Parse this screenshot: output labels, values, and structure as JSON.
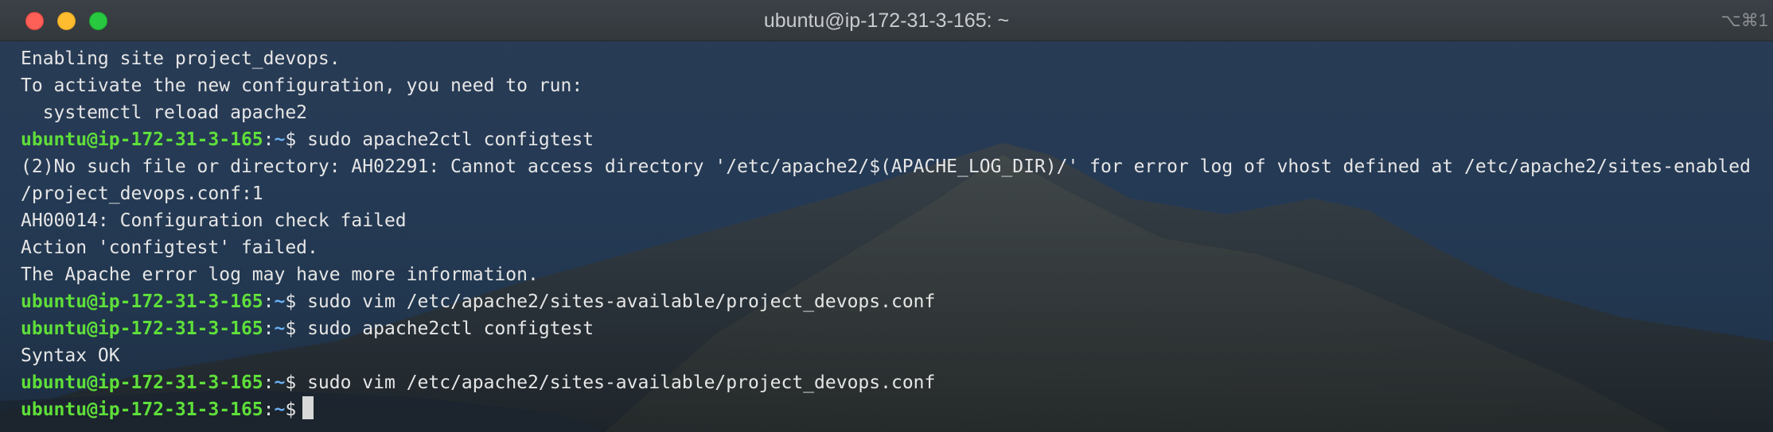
{
  "window": {
    "title": "ubuntu@ip-172-31-3-165: ~",
    "shortcut": "⌥⌘1"
  },
  "terminal": {
    "prompt_user": "ubuntu@ip-172-31-3-165",
    "prompt_path": "~",
    "prompt_symbol": "$",
    "lines": [
      {
        "type": "output",
        "text": "Enabling site project_devops."
      },
      {
        "type": "output",
        "text": "To activate the new configuration, you need to run:"
      },
      {
        "type": "output",
        "text": "  systemctl reload apache2"
      },
      {
        "type": "prompt",
        "text": " sudo apache2ctl configtest"
      },
      {
        "type": "output",
        "text": "(2)No such file or directory: AH02291: Cannot access directory '/etc/apache2/$(APACHE_LOG_DIR)/' for error log of vhost defined at /etc/apache2/sites-enabled"
      },
      {
        "type": "output",
        "text": "/project_devops.conf:1"
      },
      {
        "type": "output",
        "text": "AH00014: Configuration check failed"
      },
      {
        "type": "output",
        "text": "Action 'configtest' failed."
      },
      {
        "type": "output",
        "text": "The Apache error log may have more information."
      },
      {
        "type": "prompt",
        "text": " sudo vim /etc/apache2/sites-available/project_devops.conf"
      },
      {
        "type": "prompt",
        "text": " sudo apache2ctl configtest"
      },
      {
        "type": "output",
        "text": "Syntax OK"
      },
      {
        "type": "prompt",
        "text": " sudo vim /etc/apache2/sites-available/project_devops.conf"
      },
      {
        "type": "prompt",
        "text": ""
      }
    ]
  },
  "colors": {
    "prompt_user": "#5fdf3a",
    "prompt_path": "#6ab0f3",
    "text": "#e6e6e6",
    "close": "#fe5f57",
    "minimize": "#febc2e",
    "maximize": "#28c840"
  },
  "icons": [
    "close-button",
    "minimize-button",
    "maximize-button",
    "text-cursor"
  ]
}
